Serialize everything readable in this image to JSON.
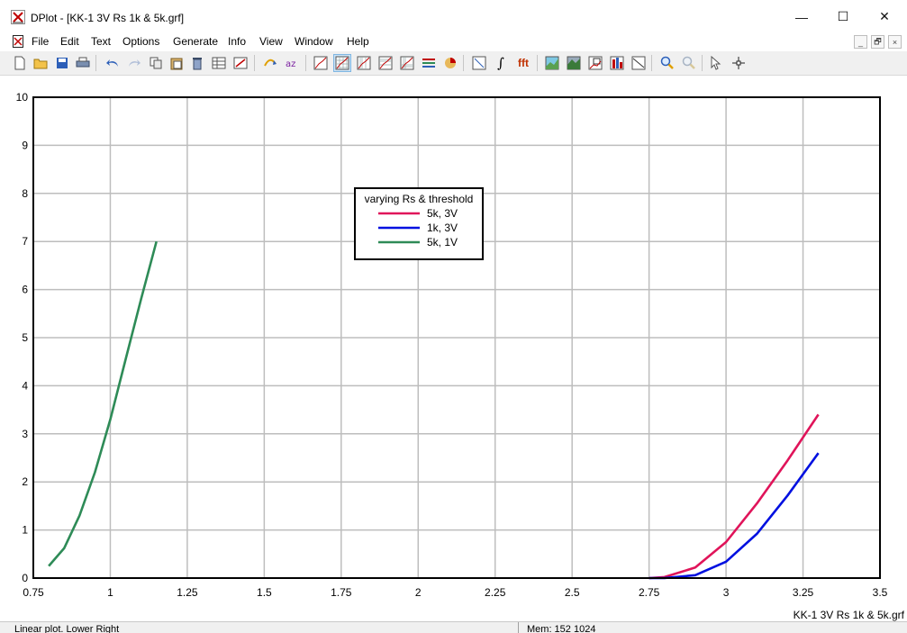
{
  "window": {
    "title": "DPlot - [KK-1 3V Rs 1k & 5k.grf]",
    "minimize_glyph": "—",
    "maximize_glyph": "☐",
    "close_glyph": "✕"
  },
  "menu": {
    "items": [
      "File",
      "Edit",
      "Text",
      "Options",
      "Generate",
      "Info",
      "View",
      "Window",
      "Help"
    ],
    "mdi_buttons": [
      "_",
      "🗗",
      "×"
    ]
  },
  "toolbar": {
    "buttons": [
      "new-icon",
      "open-folder-icon",
      "save-icon",
      "print-icon",
      "undo-icon",
      "redo-icon",
      "copy-icon",
      "paste-icon",
      "delete-icon",
      "edit-data-icon",
      "edit-table-icon",
      "translate-icon",
      "az-sort-icon",
      "linear-plot-icon",
      "grid-plot-icon",
      "semilog-x-icon",
      "semilog-y-icon",
      "log-log-icon",
      "bar-chart-icon",
      "pie-chart-icon",
      "resize-icon",
      "integral-icon",
      "fft-icon",
      "contour-icon",
      "3d-icon",
      "zoom-window-icon",
      "waterfall-icon",
      "trend-icon",
      "zoom-in-icon",
      "zoom-out-icon",
      "pointer-icon",
      "crosshair-icon"
    ],
    "fft_label": "fft",
    "integral_label": "∫"
  },
  "colors": {
    "series_5k_3v": "#e0145a",
    "series_1k_3v": "#0010e0",
    "series_5k_1v": "#2e8b57",
    "grid": "#bdbdbd",
    "frame": "#000000"
  },
  "chart_data": {
    "type": "line",
    "xlim": [
      0.75,
      3.5
    ],
    "ylim": [
      0,
      10
    ],
    "x_ticks": [
      "0.75",
      "1",
      "1.25",
      "1.5",
      "1.75",
      "2",
      "2.25",
      "2.5",
      "2.75",
      "3",
      "3.25",
      "3.5"
    ],
    "y_ticks": [
      "0",
      "1",
      "2",
      "3",
      "4",
      "5",
      "6",
      "7",
      "8",
      "9",
      "10"
    ],
    "grid": true,
    "legend_title": "varying Rs & threshold",
    "legend_position": "top-center",
    "series": [
      {
        "name": "5k, 3V",
        "x": [
          2.75,
          2.8,
          2.9,
          3.0,
          3.1,
          3.2,
          3.3
        ],
        "y": [
          0,
          0.02,
          0.22,
          0.75,
          1.55,
          2.45,
          3.4
        ]
      },
      {
        "name": "1k, 3V",
        "x": [
          2.75,
          2.8,
          2.9,
          3.0,
          3.1,
          3.2,
          3.3
        ],
        "y": [
          0,
          0,
          0.06,
          0.34,
          0.92,
          1.72,
          2.6
        ]
      },
      {
        "name": "5k, 1V",
        "x": [
          0.8,
          0.85,
          0.9,
          0.95,
          1.0,
          1.05,
          1.1,
          1.15
        ],
        "y": [
          0.25,
          0.62,
          1.3,
          2.2,
          3.3,
          4.55,
          5.8,
          7.0
        ]
      }
    ],
    "file_label": "KK-1 3V Rs 1k & 5k.grf"
  },
  "status": {
    "left": "Linear plot. Lower Right",
    "right": "Mem: 152 1024"
  }
}
